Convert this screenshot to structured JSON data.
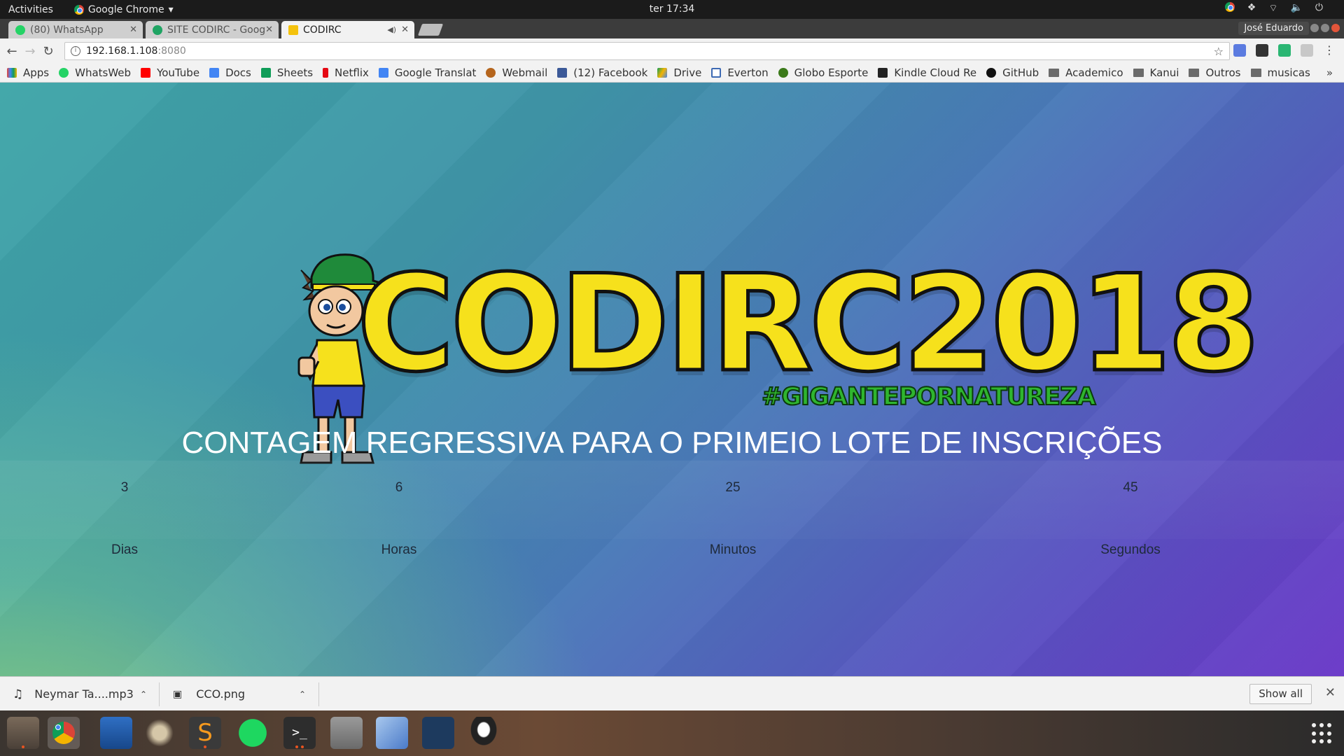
{
  "topbar": {
    "activities": "Activities",
    "app_name": "Google Chrome",
    "clock": "ter 17:34"
  },
  "tabs": [
    {
      "title": "(80) WhatsApp",
      "favicon_color": "#25d366"
    },
    {
      "title": "SITE CODIRC - Goog",
      "favicon_color": "#1fa463"
    },
    {
      "title": "CODIRC",
      "favicon_color": "#f4c20d"
    }
  ],
  "profile_name": "José Eduardo",
  "address_bar": {
    "host": "192.168.1.108",
    "port": ":8080"
  },
  "bookmarks": [
    {
      "label": "Apps",
      "color": "#e94235"
    },
    {
      "label": "WhatsWeb",
      "color": "#25d366"
    },
    {
      "label": "YouTube",
      "color": "#ff0000"
    },
    {
      "label": "Docs",
      "color": "#4285f4"
    },
    {
      "label": "Sheets",
      "color": "#0f9d58"
    },
    {
      "label": "Netflix",
      "color": "#e50914"
    },
    {
      "label": "Google Translat",
      "color": "#4285f4"
    },
    {
      "label": "Webmail",
      "color": "#b5651d"
    },
    {
      "label": "(12) Facebook",
      "color": "#3b5998"
    },
    {
      "label": "Drive",
      "color": "#f4b400"
    },
    {
      "label": "Everton",
      "color": "#3d6ab3"
    },
    {
      "label": "Globo Esporte",
      "color": "#3b7a1a"
    },
    {
      "label": "Kindle Cloud Re",
      "color": "#222222"
    },
    {
      "label": "GitHub",
      "color": "#111111"
    },
    {
      "label": "Academico",
      "folder": true
    },
    {
      "label": "Kanui",
      "folder": true
    },
    {
      "label": "Outros",
      "folder": true
    },
    {
      "label": "musicas",
      "folder": true
    }
  ],
  "page": {
    "logo_text": "CODIRC2018",
    "hashtag": "#GIGANTEPORNATUREZA",
    "headline": "CONTAGEM REGRESSIVA PARA O PRIMEIO LOTE DE INSCRIÇÕES",
    "countdown": {
      "days": {
        "value": "3",
        "label": "Dias"
      },
      "hours": {
        "value": "6",
        "label": "Horas"
      },
      "minutes": {
        "value": "25",
        "label": "Minutos"
      },
      "seconds": {
        "value": "45",
        "label": "Segundos"
      }
    }
  },
  "downloads": [
    {
      "name": "Neymar   Ta....mp3",
      "icon": "music-note-icon"
    },
    {
      "name": "CCO.png",
      "icon": "image-file-icon"
    }
  ],
  "show_all": "Show all",
  "dock": [
    "files",
    "chrome",
    "writer",
    "gimp",
    "sublime-text",
    "spotify",
    "terminal",
    "calculator",
    "virtualbox",
    "mysql-workbench",
    "inkscape"
  ]
}
